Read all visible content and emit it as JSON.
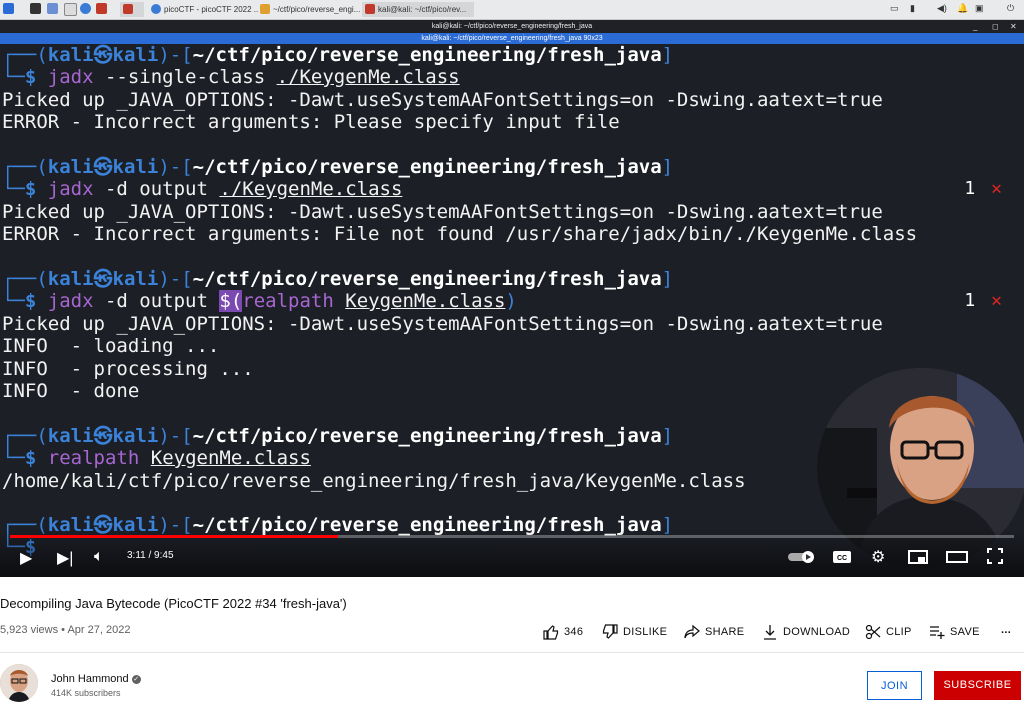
{
  "kali_panel": {
    "tabs": [
      {
        "label": "picoCTF - picoCTF 2022 ..."
      },
      {
        "label": "~/ctf/pico/reverse_engi..."
      },
      {
        "label": "kali@kali: ~/ctf/pico/rev..."
      }
    ]
  },
  "terminal_window": {
    "title_outer": "kali@kali: ~/ctf/pico/reverse_engineering/fresh_java",
    "title_inner": "kali@kali: ~/ctf/pico/reverse_engineering/fresh_java 90x23"
  },
  "terminal": {
    "prompt_user": "kali",
    "prompt_host": "kali",
    "prompt_path": "~/ctf/pico/reverse_engineering/fresh_java",
    "lines": {
      "cmd1_tool": "jadx",
      "cmd1_args": " --single-class ",
      "cmd1_file": "./KeygenMe.class",
      "out1a": "Picked up _JAVA_OPTIONS: -Dawt.useSystemAAFontSettings=on -Dswing.aatext=true",
      "out1b": "ERROR - Incorrect arguments: Please specify input file",
      "cmd2_tool": "jadx",
      "cmd2_args": " -d output ",
      "cmd2_file": "./KeygenMe.class",
      "out2a": "Picked up _JAVA_OPTIONS: -Dawt.useSystemAAFontSettings=on -Dswing.aatext=true",
      "out2b": "ERROR - Incorrect arguments: File not found /usr/share/jadx/bin/./KeygenMe.class",
      "cmd3_tool": "jadx",
      "cmd3_args": " -d output ",
      "cmd3_dollar": "$",
      "cmd3_paren": "(",
      "cmd3_realpath": "realpath",
      "cmd3_file": "KeygenMe.class",
      "cmd3_close": ")",
      "out3a": "Picked up _JAVA_OPTIONS: -Dawt.useSystemAAFontSettings=on -Dswing.aatext=true",
      "out3b": "INFO  - loading ...",
      "out3c": "INFO  - processing ...",
      "out3d": "INFO  - done",
      "cmd4_tool": "realpath",
      "cmd4_file": "KeygenMe.class",
      "out4a": "/home/kali/ctf/pico/reverse_engineering/fresh_java/KeygenMe.class",
      "cmd5_partial": "$"
    },
    "exit_status": "1"
  },
  "player": {
    "time": "3:11 / 9:45",
    "progress": 0.327
  },
  "video": {
    "title": "Decompiling Java Bytecode (PicoCTF 2022 #34 'fresh-java')",
    "views": "5,923 views",
    "date": "Apr 27, 2022",
    "likes": "346",
    "dislike_label": "DISLIKE",
    "share_label": "SHARE",
    "download_label": "DOWNLOAD",
    "clip_label": "CLIP",
    "save_label": "SAVE",
    "more_label": "..."
  },
  "channel": {
    "name": "John Hammond",
    "subscribers": "414K subscribers",
    "join_label": "JOIN",
    "subscribe_label": "SUBSCRIBE"
  },
  "colors": {
    "terminal_bg": "#1c1f26",
    "kali_blue": "#3b82d9",
    "command_purple": "#a766d0",
    "yt_red": "#cc0000",
    "join_blue": "#065fd4"
  }
}
